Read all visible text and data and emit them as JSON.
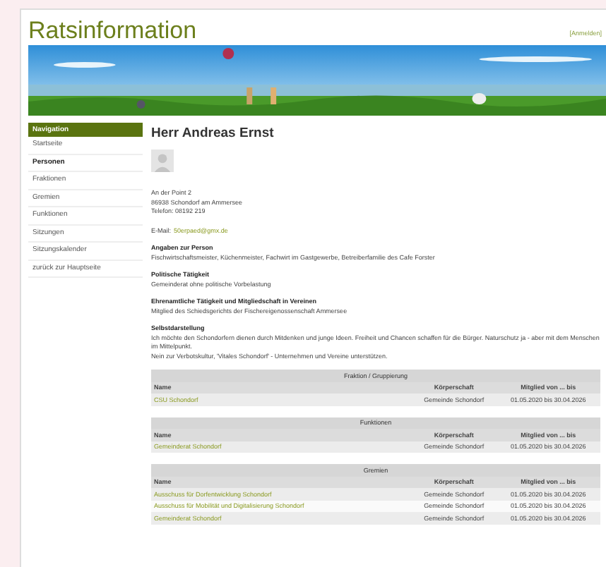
{
  "header": {
    "title": "Ratsinformation",
    "login_link": "[Anmelden]"
  },
  "navigation": {
    "heading": "Navigation",
    "items": [
      {
        "label": "Startseite",
        "selected": false
      },
      {
        "label": "Personen",
        "selected": true
      },
      {
        "label": "Fraktionen",
        "selected": false
      },
      {
        "label": "Gremien",
        "selected": false
      },
      {
        "label": "Funktionen",
        "selected": false
      },
      {
        "label": "Sitzungen",
        "selected": false
      },
      {
        "label": "Sitzungskalender",
        "selected": false
      },
      {
        "label": "zurück zur Hauptseite",
        "selected": false
      }
    ]
  },
  "person": {
    "name": "Herr Andreas Ernst",
    "address": [
      "An der Point 2",
      "86938 Schondorf am Ammersee",
      "Telefon: 08192 219"
    ],
    "email_label": "E-Mail:",
    "email": "50erpaed@gmx.de"
  },
  "sections": [
    {
      "heading": "Angaben zur Person",
      "lines": [
        "Fischwirtschaftsmeister, Küchenmeister, Fachwirt im Gastgewerbe, Betreiberfamilie des Cafe Forster"
      ]
    },
    {
      "heading": "Politische Tätigkeit",
      "lines": [
        "Gemeinderat ohne politische Vorbelastung"
      ]
    },
    {
      "heading": "Ehrenamtliche Tätigkeit und Mitgliedschaft in Vereinen",
      "lines": [
        "Mitglied des Schiedsgerichts der Fischereigenossenschaft Ammersee"
      ]
    },
    {
      "heading": "Selbstdarstellung",
      "lines": [
        "Ich möchte den Schondorfern dienen durch Mitdenken und junge Ideen. Freiheit und Chancen schaffen für die Bürger. Naturschutz ja - aber mit dem Menschen im Mittelpunkt.",
        "Nein zur Verbotskultur, 'Vitales Schondorf' - Unternehmen und Vereine unterstützen."
      ]
    }
  ],
  "tables": [
    {
      "title": "Fraktion / Gruppierung",
      "columns": [
        "Name",
        "Körperschaft",
        "Mitglied von ... bis"
      ],
      "rows": [
        [
          "CSU Schondorf",
          "Gemeinde Schondorf",
          "01.05.2020 bis 30.04.2026"
        ]
      ]
    },
    {
      "title": "Funktionen",
      "columns": [
        "Name",
        "Körperschaft",
        "Mitglied von ... bis"
      ],
      "rows": [
        [
          "Gemeinderat Schondorf",
          "Gemeinde Schondorf",
          "01.05.2020 bis 30.04.2026"
        ]
      ]
    },
    {
      "title": "Gremien",
      "columns": [
        "Name",
        "Körperschaft",
        "Mitglied von ... bis"
      ],
      "rows": [
        [
          "Ausschuss für Dorfentwicklung Schondorf",
          "Gemeinde Schondorf",
          "01.05.2020 bis 30.04.2026"
        ],
        [
          "Ausschuss für Mobilität und Digitalisierung Schondorf",
          "Gemeinde Schondorf",
          "01.05.2020 bis 30.04.2026"
        ],
        [
          "Gemeinderat Schondorf",
          "Gemeinde Schondorf",
          "01.05.2020 bis 30.04.2026"
        ]
      ]
    }
  ]
}
